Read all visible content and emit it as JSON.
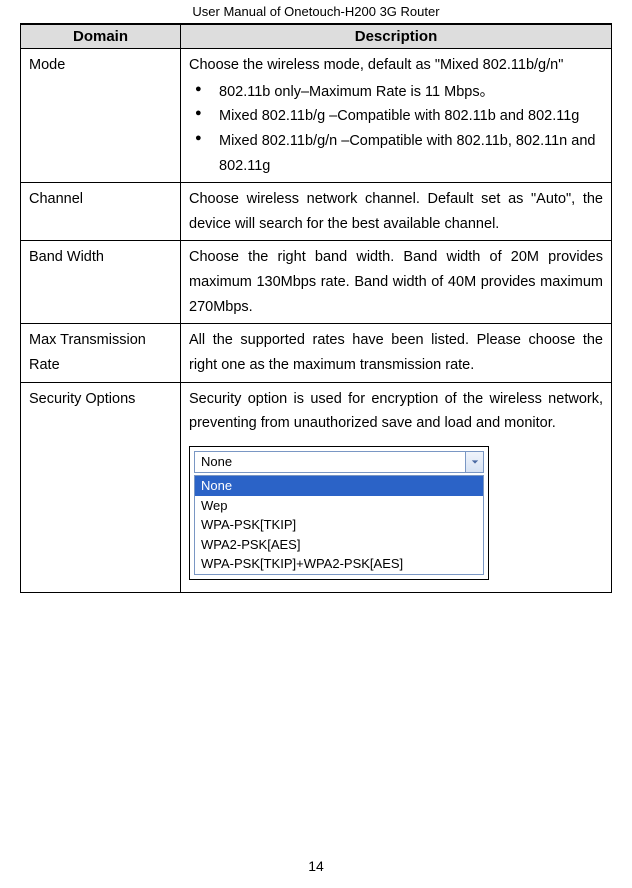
{
  "header": {
    "title": "User Manual of Onetouch-H200 3G Router"
  },
  "table": {
    "headers": {
      "domain": "Domain",
      "description": "Description"
    },
    "rows": [
      {
        "domain": "Mode",
        "intro": "Choose the wireless mode, default as \"Mixed 802.11b/g/n\"",
        "bullets": [
          "802.11b only–Maximum Rate is 11 Mbps。",
          "Mixed 802.11b/g –Compatible with 802.11b and 802.11g",
          "Mixed 802.11b/g/n –Compatible with 802.11b, 802.11n and 802.11g"
        ]
      },
      {
        "domain": "Channel",
        "description": "Choose wireless network channel. Default set as \"Auto\", the device will search for the best available channel."
      },
      {
        "domain": "Band Width",
        "description": "Choose the right band width. Band width of 20M provides maximum 130Mbps rate. Band width of 40M provides maximum 270Mbps."
      },
      {
        "domain": "Max Transmission Rate",
        "description": "All the supported rates have been listed. Please choose the right one as the maximum transmission rate."
      },
      {
        "domain": "Security Options",
        "description": "Security option is used for encryption of the wireless network, preventing from unauthorized save and load and monitor.",
        "dropdown": {
          "selected": "None",
          "options": [
            "None",
            "Wep",
            "WPA-PSK[TKIP]",
            "WPA2-PSK[AES]",
            "WPA-PSK[TKIP]+WPA2-PSK[AES]"
          ]
        }
      }
    ]
  },
  "page_number": "14"
}
